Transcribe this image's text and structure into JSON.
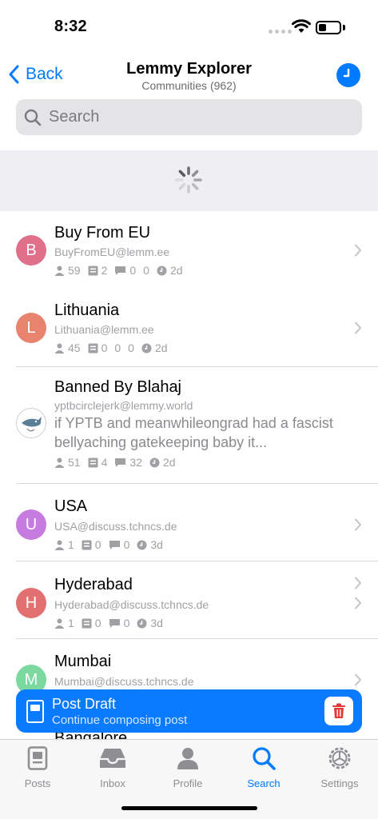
{
  "status": {
    "time": "8:32",
    "battery_level": 0.3
  },
  "nav": {
    "back_label": "Back",
    "title": "Lemmy Explorer",
    "subtitle": "Communities (962)"
  },
  "search": {
    "placeholder": "Search"
  },
  "communities": [
    {
      "name": "Buy From EU",
      "handle": "BuyFromEU@lemm.ee",
      "initial": "B",
      "color": "#e0708a",
      "subscribers": "59",
      "posts": "2",
      "comments": "0",
      "active": "0",
      "age": "2d"
    },
    {
      "name": "Lithuania",
      "handle": "Lithuania@lemm.ee",
      "initial": "L",
      "color": "#e88370",
      "subscribers": "45",
      "posts": "0",
      "comments": "0",
      "active": "0",
      "age": "2d"
    },
    {
      "name": "Banned By Blahaj",
      "handle": "yptbcirclejerk@lemmy.world",
      "description": "if YPTB and meanwhileongrad had a fascist bellyaching gatekeeping baby it...",
      "subscribers": "51",
      "posts": "4",
      "comments": "32",
      "active": "",
      "age": "2d"
    },
    {
      "name": "USA",
      "handle": "USA@discuss.tchncs.de",
      "initial": "U",
      "color": "#c77ae0",
      "subscribers": "1",
      "posts": "0",
      "comments": "0",
      "active": "",
      "age": "3d"
    },
    {
      "name": "Hyderabad",
      "handle": "Hyderabad@discuss.tchncs.de",
      "initial": "H",
      "color": "#e37070",
      "subscribers": "1",
      "posts": "0",
      "comments": "0",
      "active": "",
      "age": "3d"
    },
    {
      "name": "Mumbai",
      "handle": "Mumbai@discuss.tchncs.de",
      "initial": "M",
      "color": "#7bd9a0"
    }
  ],
  "peek_row": {
    "name": "Bangalore"
  },
  "draft": {
    "title": "Post Draft",
    "subtitle": "Continue composing post"
  },
  "tabs": [
    {
      "label": "Posts",
      "icon": "posts-icon"
    },
    {
      "label": "Inbox",
      "icon": "inbox-icon"
    },
    {
      "label": "Profile",
      "icon": "profile-icon"
    },
    {
      "label": "Search",
      "icon": "search-icon",
      "active": true
    },
    {
      "label": "Settings",
      "icon": "settings-icon"
    }
  ],
  "colors": {
    "accent": "#007aff",
    "banner": "#0a7aff",
    "trash": "#e53935"
  }
}
